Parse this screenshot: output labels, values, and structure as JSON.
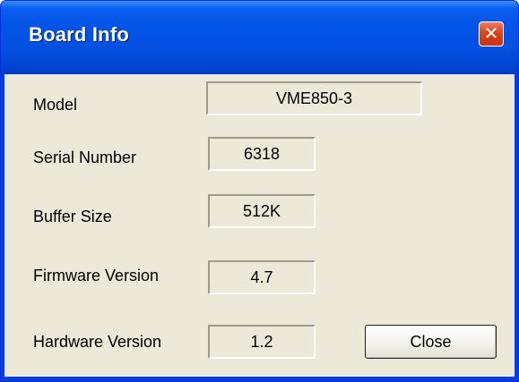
{
  "window": {
    "title": "Board Info",
    "close_glyph": "✕"
  },
  "fields": [
    {
      "label": "Model",
      "value": "VME850-3"
    },
    {
      "label": "Serial Number",
      "value": "6318"
    },
    {
      "label": "Buffer Size",
      "value": "512K"
    },
    {
      "label": "Firmware Version",
      "value": "4.7"
    },
    {
      "label": "Hardware Version",
      "value": "1.2"
    }
  ],
  "buttons": {
    "close_label": "Close"
  },
  "colors": {
    "titlebar": "#0250e2",
    "dialog_face": "#ece9d8",
    "close_x": "#d8471c"
  }
}
